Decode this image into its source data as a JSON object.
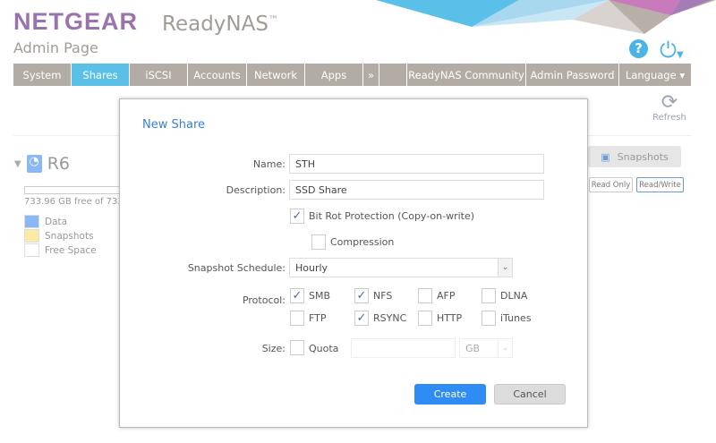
{
  "header": {
    "brand": "NETGEAR",
    "product": "ReadyNAS",
    "tm": "™",
    "subtitle": "Admin Page"
  },
  "nav": {
    "tabs": [
      {
        "label": "System"
      },
      {
        "label": "Shares",
        "active": true
      },
      {
        "label": "iSCSI"
      },
      {
        "label": "Accounts"
      },
      {
        "label": "Network"
      },
      {
        "label": "Apps"
      },
      {
        "label": "»"
      },
      {
        "label": ""
      },
      {
        "label": "ReadyNAS Community"
      },
      {
        "label": "Admin Password"
      },
      {
        "label": "Language ▾"
      }
    ]
  },
  "toolbar": {
    "refresh_label": "Refresh",
    "help_icon": "?",
    "power_icon": "⏻"
  },
  "volume": {
    "name": "R6",
    "free_text": "733.96 GB free of 733",
    "legend": [
      {
        "label": "Data",
        "color": "#8ab8f5"
      },
      {
        "label": "Snapshots",
        "color": "#fbeaa6"
      },
      {
        "label": "Free Space",
        "color": "#ffffff"
      }
    ],
    "snapshots_label": "Snapshots",
    "read_only": "Read Only",
    "read_write": "Read/Write"
  },
  "dialog": {
    "title": "New Share",
    "name_label": "Name:",
    "name_value": "STH",
    "desc_label": "Description:",
    "desc_value": "SSD Share",
    "bitrot_label": "Bit Rot Protection (Copy-on-write)",
    "bitrot_checked": true,
    "compression_label": "Compression",
    "compression_checked": false,
    "schedule_label": "Snapshot Schedule:",
    "schedule_value": "Hourly",
    "protocol_label": "Protocol:",
    "protocols": [
      {
        "label": "SMB",
        "checked": true
      },
      {
        "label": "NFS",
        "checked": true
      },
      {
        "label": "AFP",
        "checked": false
      },
      {
        "label": "DLNA",
        "checked": false
      },
      {
        "label": "FTP",
        "checked": false
      },
      {
        "label": "RSYNC",
        "checked": true
      },
      {
        "label": "HTTP",
        "checked": false
      },
      {
        "label": "iTunes",
        "checked": false
      }
    ],
    "size_label": "Size:",
    "quota_label": "Quota",
    "quota_checked": false,
    "quota_value": "",
    "unit_value": "GB",
    "create_label": "Create",
    "cancel_label": "Cancel"
  }
}
